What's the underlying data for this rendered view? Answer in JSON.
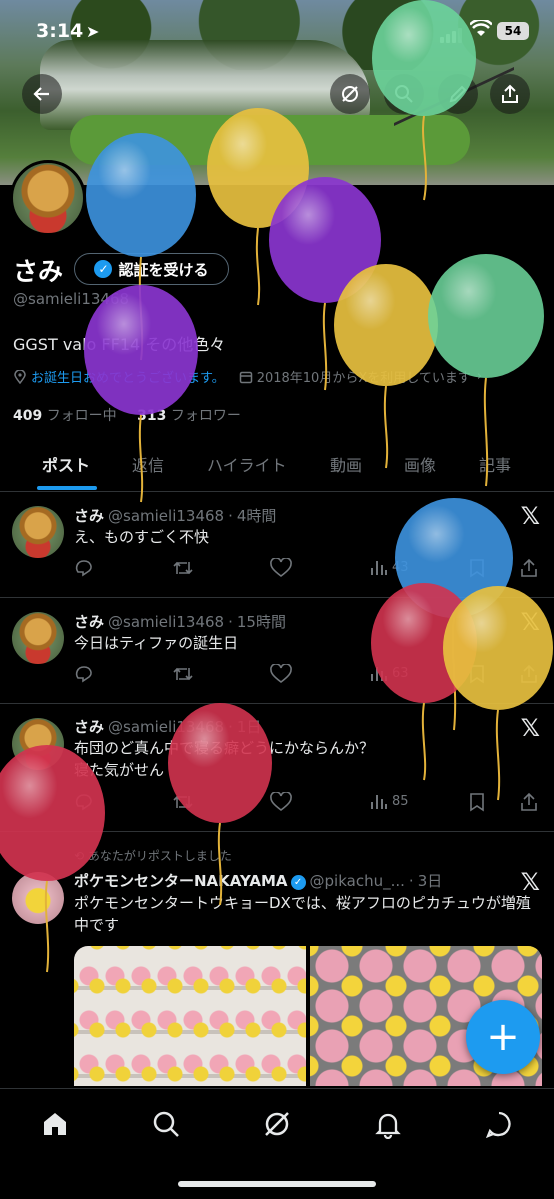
{
  "status_bar": {
    "time": "3:14",
    "battery": "54"
  },
  "profile": {
    "name": "さみ",
    "verify_button": "認証を受ける",
    "handle": "@samieli13468",
    "bio": "GGST valo FF14 その他色々",
    "birthday_text": "お誕生日おめでとうございます。",
    "joined_text": "2018年10月からXを利用しています",
    "following_count": "409",
    "following_label": "フォロー中",
    "followers_count": "313",
    "followers_label": "フォロワー"
  },
  "tabs": [
    "ポスト",
    "返信",
    "ハイライト",
    "動画",
    "画像",
    "記事"
  ],
  "posts": [
    {
      "name": "さみ",
      "handle": "@samieli13468",
      "time": "4時間",
      "text": "え、ものすごく不快",
      "views": "43"
    },
    {
      "name": "さみ",
      "handle": "@samieli13468",
      "time": "15時間",
      "text": "今日はティファの誕生日",
      "views": "63"
    },
    {
      "name": "さみ",
      "handle": "@samieli13468",
      "time": "1日",
      "text_line1": "布団のど真ん中で寝る癖どうにかならんか？",
      "text_line2": "寝た気がせん",
      "views": "85"
    },
    {
      "repost_label": "あなたがリポストしました",
      "name": "ポケモンセンターNAKAYAMA",
      "handle": "@pikachu_...",
      "time": "3日",
      "text": "ポケモンセンタートウキョーDXでは、桜アフロのピカチュウが増殖中です"
    }
  ],
  "icons": {
    "back": "back-arrow-icon",
    "grok": "grok-icon",
    "search": "search-icon",
    "edit": "pencil-icon",
    "share": "share-icon",
    "reply": "reply-icon",
    "repost": "repost-icon",
    "like": "heart-icon",
    "views": "bar-chart-icon",
    "bookmark": "bookmark-icon"
  },
  "colors": {
    "accent": "#1d9bf0",
    "background": "#000000",
    "muted": "#71767b"
  }
}
